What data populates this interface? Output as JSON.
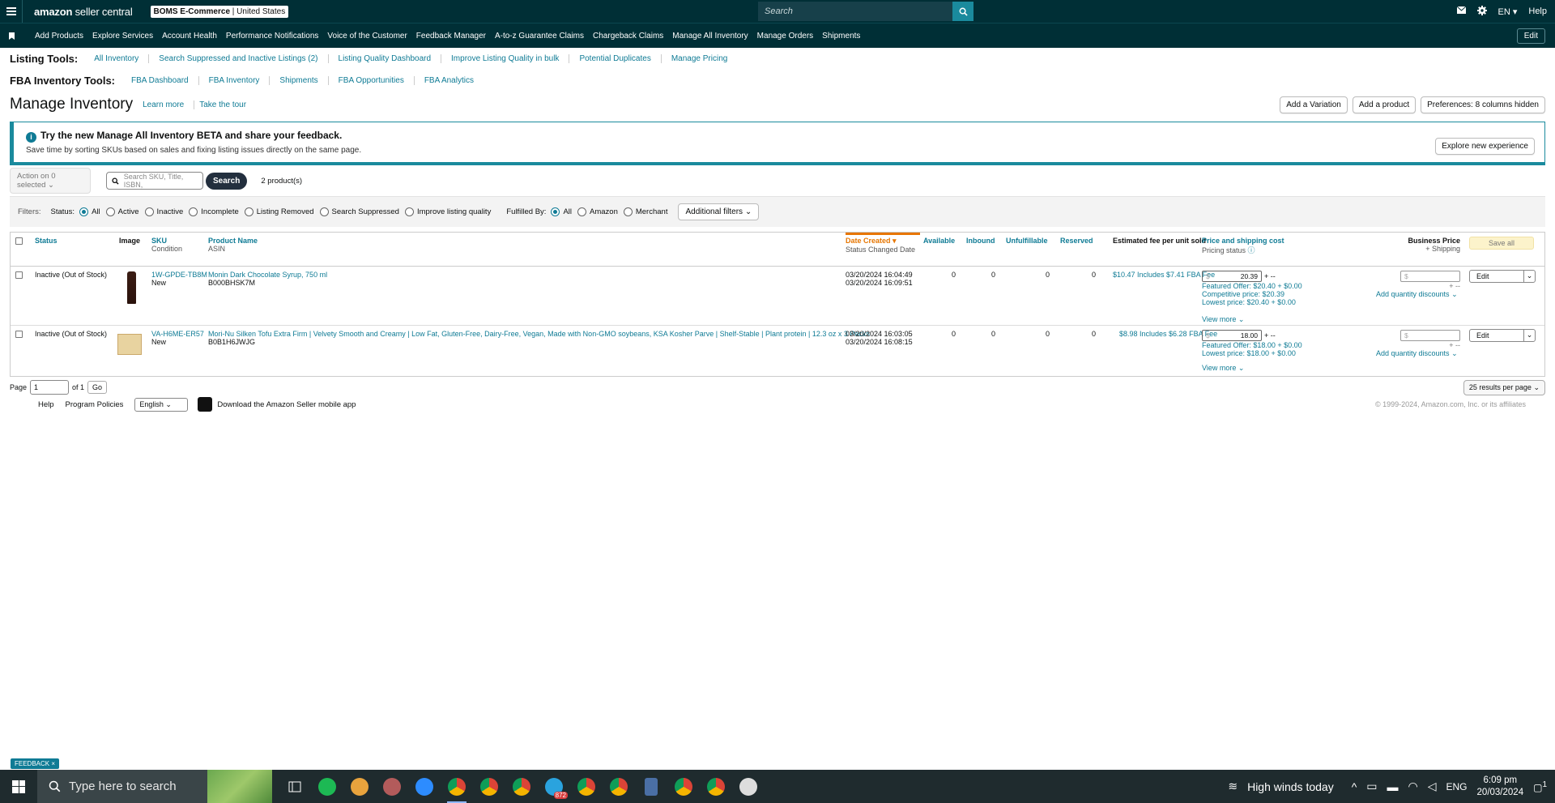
{
  "topbar": {
    "logo_brand": "amazon",
    "logo_text": "seller central",
    "store_name": "BOMS E-Commerce",
    "store_region": "United States",
    "search_placeholder": "Search",
    "language": "EN",
    "help": "Help"
  },
  "nav": {
    "items": [
      "Add Products",
      "Explore Services",
      "Account Health",
      "Performance Notifications",
      "Voice of the Customer",
      "Feedback Manager",
      "A-to-z Guarantee Claims",
      "Chargeback Claims",
      "Manage All Inventory",
      "Manage Orders",
      "Shipments"
    ],
    "edit": "Edit"
  },
  "listing_tools": {
    "title": "Listing Tools:",
    "links": [
      "All Inventory",
      "Search Suppressed and Inactive Listings (2)",
      "Listing Quality Dashboard",
      "Improve Listing Quality in bulk",
      "Potential Duplicates",
      "Manage Pricing"
    ]
  },
  "fba_tools": {
    "title": "FBA Inventory Tools:",
    "links": [
      "FBA Dashboard",
      "FBA Inventory",
      "Shipments",
      "FBA Opportunities",
      "FBA Analytics"
    ]
  },
  "page": {
    "title": "Manage Inventory",
    "learn_more": "Learn more",
    "tour": "Take the tour",
    "add_variation": "Add a Variation",
    "add_product": "Add a product",
    "preferences": "Preferences: 8 columns hidden"
  },
  "banner": {
    "icon": "i",
    "title": "Try the new Manage All Inventory BETA and share your feedback.",
    "text": "Save time by sorting SKUs based on sales and fixing listing issues directly on the same page.",
    "button": "Explore new experience"
  },
  "actions": {
    "action_select": "Action on 0 selected",
    "search_placeholder": "Search SKU, Title, ISBN,",
    "search_button": "Search",
    "count": "2 product(s)"
  },
  "filters": {
    "label": "Filters:",
    "status_label": "Status:",
    "status_options": [
      "All",
      "Active",
      "Inactive",
      "Incomplete",
      "Listing Removed",
      "Search Suppressed",
      "Improve listing quality"
    ],
    "status_selected": "All",
    "fulfilled_label": "Fulfilled By:",
    "fulfilled_options": [
      "All",
      "Amazon",
      "Merchant"
    ],
    "fulfilled_selected": "All",
    "additional": "Additional filters"
  },
  "table": {
    "headers": {
      "status": "Status",
      "image": "Image",
      "sku": "SKU",
      "condition": "Condition",
      "product_name": "Product Name",
      "asin": "ASIN",
      "date_created": "Date Created",
      "status_changed": "Status Changed Date",
      "available": "Available",
      "inbound": "Inbound",
      "unfulfillable": "Unfulfillable",
      "reserved": "Reserved",
      "est_fee": "Estimated fee per unit sold",
      "price_shipping": "Price and shipping cost",
      "pricing_status": "Pricing status",
      "business_price": "Business Price",
      "plus_shipping": "+ Shipping",
      "save_all": "Save all"
    },
    "rows": [
      {
        "status": "Inactive (Out of Stock)",
        "sku": "1W-GPDE-TB8M",
        "condition": "New",
        "name": "Monin Dark Chocolate Syrup, 750 ml",
        "asin": "B000BHSK7M",
        "date_created": "03/20/2024 16:04:49",
        "status_changed": "03/20/2024 16:09:51",
        "available": "0",
        "inbound": "0",
        "unfulfillable": "0",
        "reserved": "0",
        "fee": "$10.47 Includes $7.41 FBA Fee",
        "price": "20.39",
        "plus": "+ --",
        "featured": "Featured Offer: $20.40 + $0.00",
        "competitive": "Competitive price: $20.39",
        "lowest": "Lowest price: $20.40 + $0.00",
        "view_more": "View more",
        "business_placeholder": "$",
        "biz_plus": "+ --",
        "qty_discounts": "Add quantity discounts",
        "edit": "Edit"
      },
      {
        "status": "Inactive (Out of Stock)",
        "sku": "VA-H6ME-ER57",
        "condition": "New",
        "name": "Mori-Nu Silken Tofu Extra Firm | Velvety Smooth and Creamy | Low Fat, Gluten-Free, Dairy-Free, Vegan, Made with Non-GMO soybeans, KSA Kosher Parve | Shelf-Stable | Plant protein | 12.3 oz x 3 Packs",
        "asin": "B0B1H6JWJG",
        "date_created": "03/20/2024 16:03:05",
        "status_changed": "03/20/2024 16:08:15",
        "available": "0",
        "inbound": "0",
        "unfulfillable": "0",
        "reserved": "0",
        "fee": "$8.98 Includes $6.28 FBA Fee",
        "price": "18.00",
        "plus": "+ --",
        "featured": "Featured Offer: $18.00 + $0.00",
        "lowest": "Lowest price: $18.00 + $0.00",
        "view_more": "View more",
        "business_placeholder": "$",
        "biz_plus": "+ --",
        "qty_discounts": "Add quantity discounts",
        "edit": "Edit"
      }
    ]
  },
  "pager": {
    "page_label": "Page",
    "page_value": "1",
    "of": "of 1",
    "go": "Go",
    "per_page": "25 results per page"
  },
  "footer": {
    "help": "Help",
    "policies": "Program Policies",
    "language": "English",
    "app": "Download the Amazon Seller mobile app",
    "copyright": "© 1999-2024, Amazon.com, Inc. or its affiliates"
  },
  "feedback": "FEEDBACK ×",
  "taskbar": {
    "search_placeholder": "Type here to search",
    "telegram_badge": "872",
    "weather": "High winds today",
    "lang": "ENG",
    "time": "6:09 pm",
    "date": "20/03/2024",
    "notif": "1"
  },
  "colors": {
    "header_bg": "#002f36",
    "link": "#0f7b95",
    "accent": "#1a8a9d",
    "sort_orange": "#e77600"
  }
}
